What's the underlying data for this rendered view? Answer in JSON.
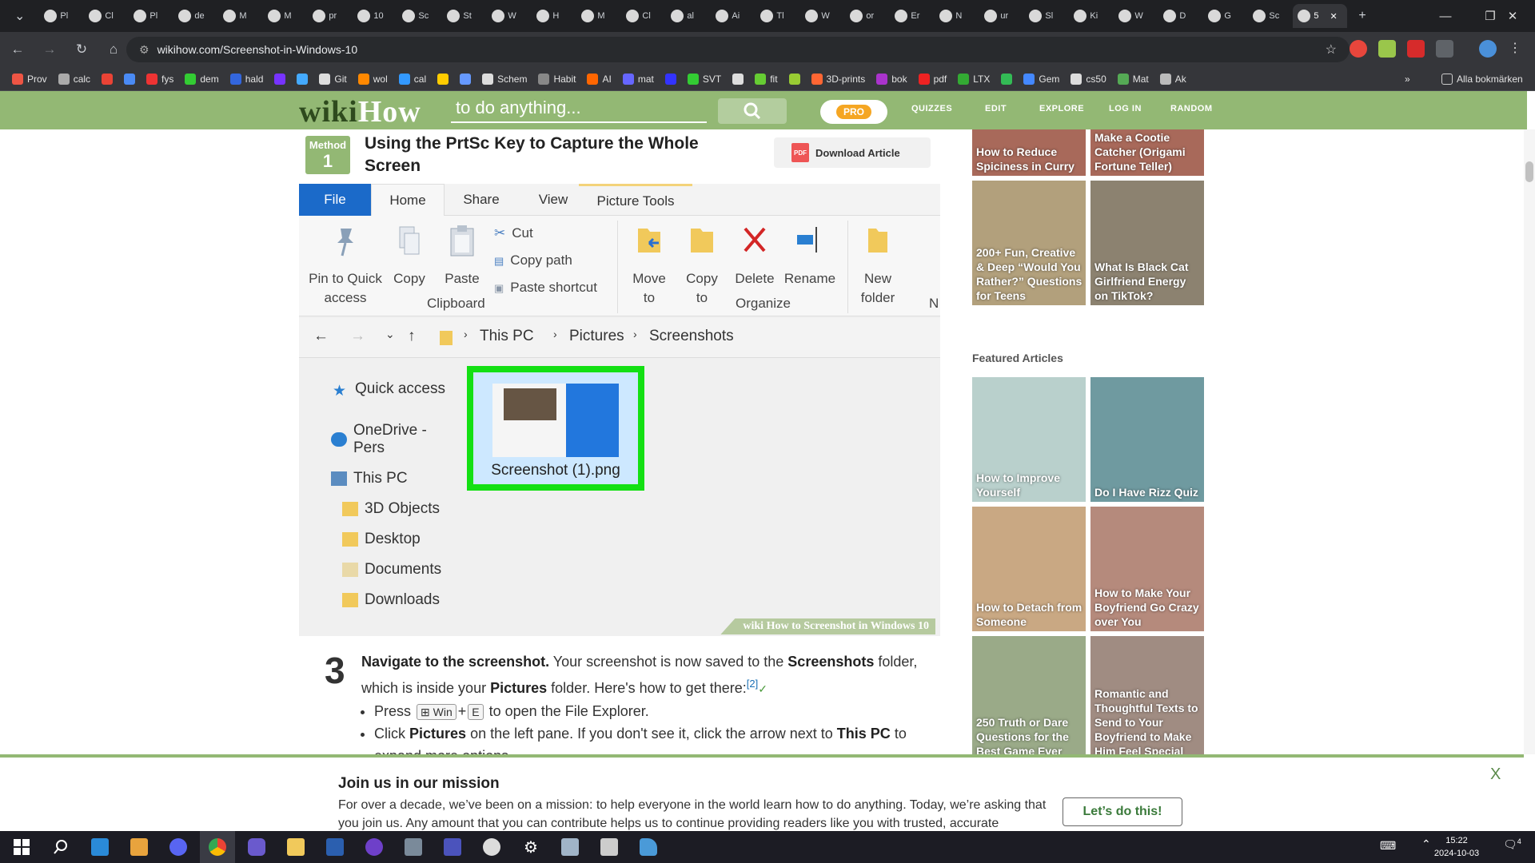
{
  "browser": {
    "tabs": [
      {
        "label": "Pl"
      },
      {
        "label": "Cl"
      },
      {
        "label": "Pl"
      },
      {
        "label": "de"
      },
      {
        "label": "M"
      },
      {
        "label": "M"
      },
      {
        "label": "pr"
      },
      {
        "label": "10"
      },
      {
        "label": "Sc"
      },
      {
        "label": "St"
      },
      {
        "label": "W"
      },
      {
        "label": "H"
      },
      {
        "label": "M"
      },
      {
        "label": "Cl"
      },
      {
        "label": "al"
      },
      {
        "label": "Ai"
      },
      {
        "label": "Tl"
      },
      {
        "label": "W"
      },
      {
        "label": "or"
      },
      {
        "label": "Er"
      },
      {
        "label": "N"
      },
      {
        "label": "ur"
      },
      {
        "label": "Sl"
      },
      {
        "label": "Ki"
      },
      {
        "label": "W"
      },
      {
        "label": "D"
      },
      {
        "label": "G"
      },
      {
        "label": "Sc"
      },
      {
        "label": "5"
      }
    ],
    "url": "wikihow.com/Screenshot-in-Windows-10",
    "bookmarks": [
      "Prov",
      "calc",
      "",
      "",
      "fys",
      "dem",
      "hald",
      "",
      "",
      "Git",
      "wol",
      "cal",
      "",
      "",
      "Schem",
      "Habit",
      "AI",
      "mat",
      "",
      "SVT",
      "",
      "fit",
      "",
      "3D-prints",
      "bok",
      "pdf",
      "LTX",
      "",
      "Gem",
      "cs50",
      "Mat",
      "Ak"
    ],
    "bookmarks_overflow": "»",
    "all_bookmarks": "Alla bokmärken"
  },
  "wikihow": {
    "logo_a": "wiki",
    "logo_b": "How",
    "search_placeholder": "to do anything...",
    "pro": "PRO",
    "nav": [
      "QUIZZES",
      "EDIT",
      "EXPLORE",
      "LOG IN",
      "RANDOM"
    ]
  },
  "article": {
    "method_label": "Method",
    "method_number": "1",
    "title": "Using the PrtSc Key to Capture the Whole Screen",
    "download": "Download Article",
    "pdf_label": "PDF",
    "screenshot": {
      "tabs": [
        "File",
        "Home",
        "Share",
        "View",
        "Picture Tools"
      ],
      "ribbon": {
        "pin": "Pin to Quick access",
        "copy": "Copy",
        "paste": "Paste",
        "cut": "Cut",
        "copy_path": "Copy path",
        "paste_shortcut": "Paste shortcut",
        "move_to": "Move to",
        "copy_to": "Copy to",
        "delete": "Delete",
        "rename": "Rename",
        "new_folder": "New folder",
        "group_clipboard": "Clipboard",
        "group_organize": "Organize",
        "group_new": "N"
      },
      "breadcrumb": [
        "This PC",
        "Pictures",
        "Screenshots"
      ],
      "nav_pane": [
        "Quick access",
        "OneDrive - Pers",
        "This PC",
        "3D Objects",
        "Desktop",
        "Documents",
        "Downloads"
      ],
      "file_name": "Screenshot (1).png",
      "watermark_a": "wiki",
      "watermark_b": "How to Screenshot in Windows 10"
    },
    "step": {
      "number": "3",
      "lead": "Navigate to the screenshot.",
      "text_1": "Your screenshot is now saved to the",
      "bold_1": "Screenshots",
      "text_2": "folder, which is inside your",
      "bold_2": "Pictures",
      "text_3": "folder. Here's how to get there:",
      "cite": "[2]",
      "bullet_1_pre": "Press",
      "key_win": "⊞ Win",
      "plus": "+",
      "key_e": "E",
      "bullet_1_post": "to open the File Explorer.",
      "bullet_2_pre": "Click",
      "bullet_2_bold": "Pictures",
      "bullet_2_mid": "on the left pane. If you don't see it, click the arrow next to",
      "bullet_2_bold2": "This PC",
      "bullet_2_post": "to",
      "bullet_2_cut": "expand more options."
    }
  },
  "sidebar": {
    "related": [
      "How to Reduce Spiciness in Curry",
      "Make a Cootie Catcher (Origami Fortune Teller)",
      "200+ Fun, Creative & Deep “Would You Rather?” Questions for Teens",
      "What Is Black Cat Girlfriend Energy on TikTok?"
    ],
    "featured_title": "Featured Articles",
    "featured": [
      "How to Improve Yourself",
      "Do I Have Rizz Quiz",
      "How to Detach from Someone",
      "How to Make Your Boyfriend Go Crazy over You",
      "250 Truth or Dare Questions for the Best Game Ever",
      "Romantic and Thoughtful Texts to Send to Your Boyfriend to Make Him Feel Special"
    ]
  },
  "banner": {
    "title": "Join us in our mission",
    "text": "For over a decade, we’ve been on a mission: to help everyone in the world learn how to do anything. Today, we’re asking that you join us. Any amount that you can contribute helps us to continue providing readers like you with trusted, accurate",
    "button": "Let’s do this!",
    "close": "X"
  },
  "taskbar": {
    "time": "15:22",
    "date": "2024-10-03",
    "notif_count": "4"
  },
  "colors": {
    "wikihow_green": "#93b874",
    "file_tab_blue": "#1b6ac9",
    "highlight_green": "#13e013"
  }
}
